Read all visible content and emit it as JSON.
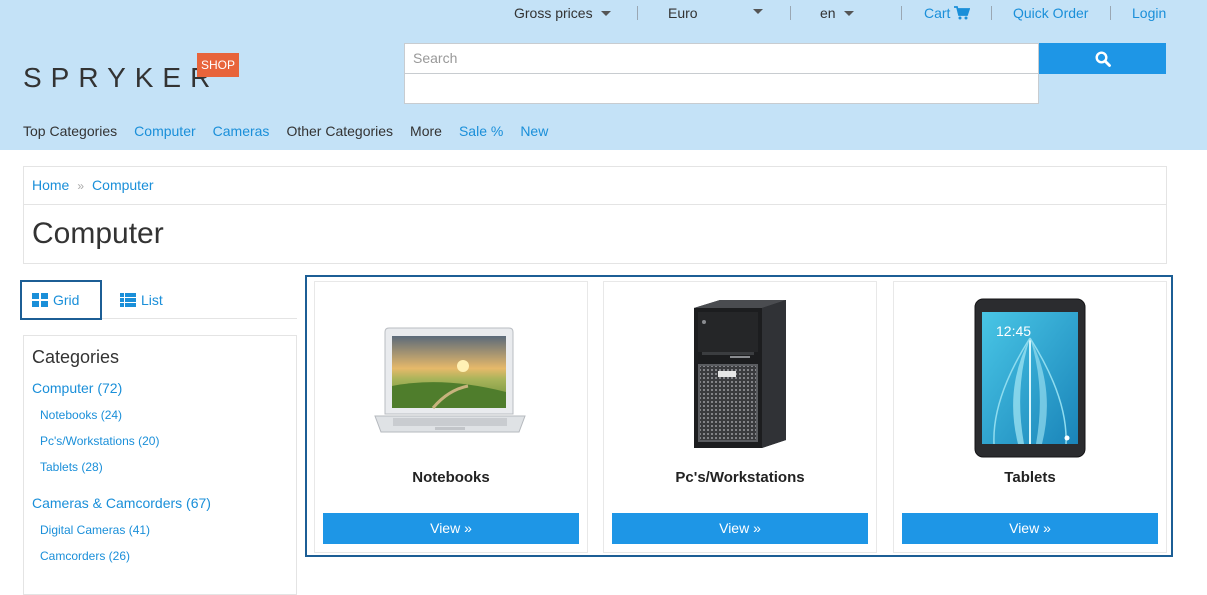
{
  "topbar": {
    "price_mode": "Gross prices",
    "currency": "Euro",
    "language": "en",
    "cart": "Cart",
    "quick_order": "Quick Order",
    "login": "Login"
  },
  "brand": {
    "logo": "SPRYKER",
    "badge": "SHOP"
  },
  "search": {
    "placeholder": "Search"
  },
  "nav": [
    {
      "label": "Top Categories"
    },
    {
      "label": "Computer"
    },
    {
      "label": "Cameras"
    },
    {
      "label": "Other Categories"
    },
    {
      "label": "More"
    },
    {
      "label": "Sale %"
    },
    {
      "label": "New"
    }
  ],
  "breadcrumb": {
    "home": "Home",
    "sep": "»",
    "current": "Computer"
  },
  "page_title": "Computer",
  "view_toggle": {
    "grid": "Grid",
    "list": "List"
  },
  "categories": {
    "title": "Categories",
    "items": [
      {
        "label": "Computer (72)"
      },
      {
        "label": "Notebooks (24)"
      },
      {
        "label": "Pc's/Workstations (20)"
      },
      {
        "label": "Tablets (28)"
      },
      {
        "label": "Cameras & Camcorders (67)"
      },
      {
        "label": "Digital Cameras (41)"
      },
      {
        "label": "Camcorders (26)"
      }
    ]
  },
  "products": [
    {
      "name": "Notebooks",
      "button": "View »"
    },
    {
      "name": "Pc's/Workstations",
      "button": "View »"
    },
    {
      "name": "Tablets",
      "button": "View »"
    }
  ],
  "tablet_screen_time": "12:45",
  "colors": {
    "header_bg": "#c4e2f7",
    "accent": "#1e96e6",
    "badge": "#e8643b",
    "focus_border": "#1c5e95"
  }
}
